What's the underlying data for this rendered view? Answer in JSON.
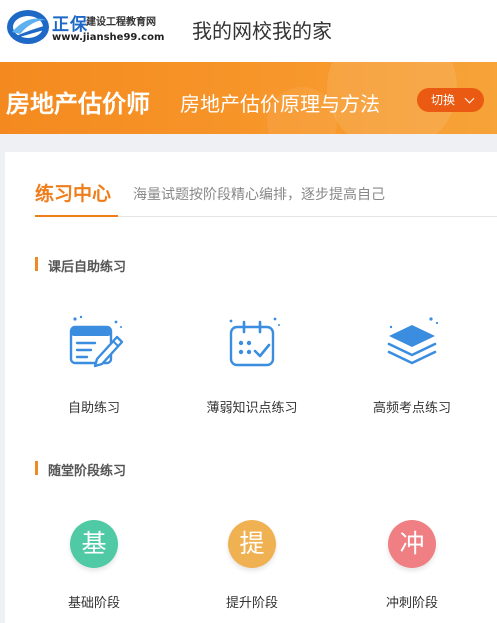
{
  "header": {
    "brand": "正保",
    "brand_sub": "建设工程教育网",
    "url": "www.jianshe99.com",
    "slogan": "我的网校我的家"
  },
  "banner": {
    "exam": "房地产估价师",
    "subject": "房地产估价原理与方法",
    "switch_label": "切换"
  },
  "tabs": {
    "active": "练习中心",
    "description": "海量试题按阶段精心编排，逐步提高自己"
  },
  "section_after_class": {
    "title": "课后自助练习",
    "items": [
      {
        "label": "自助练习",
        "icon": "notebook-pen-icon"
      },
      {
        "label": "薄弱知识点练习",
        "icon": "calendar-check-icon"
      },
      {
        "label": "高频考点练习",
        "icon": "layers-icon"
      }
    ]
  },
  "section_stage": {
    "title": "随堂阶段练习",
    "items": [
      {
        "label": "基础阶段",
        "glyph": "基"
      },
      {
        "label": "提升阶段",
        "glyph": "提"
      },
      {
        "label": "冲刺阶段",
        "glyph": "冲"
      }
    ]
  },
  "colors": {
    "accent": "#ef7d1a",
    "icon_blue": "#3b8de0",
    "stage_basic": "#4fcaa4",
    "stage_improve": "#f0b152",
    "stage_sprint": "#ef7f83"
  }
}
